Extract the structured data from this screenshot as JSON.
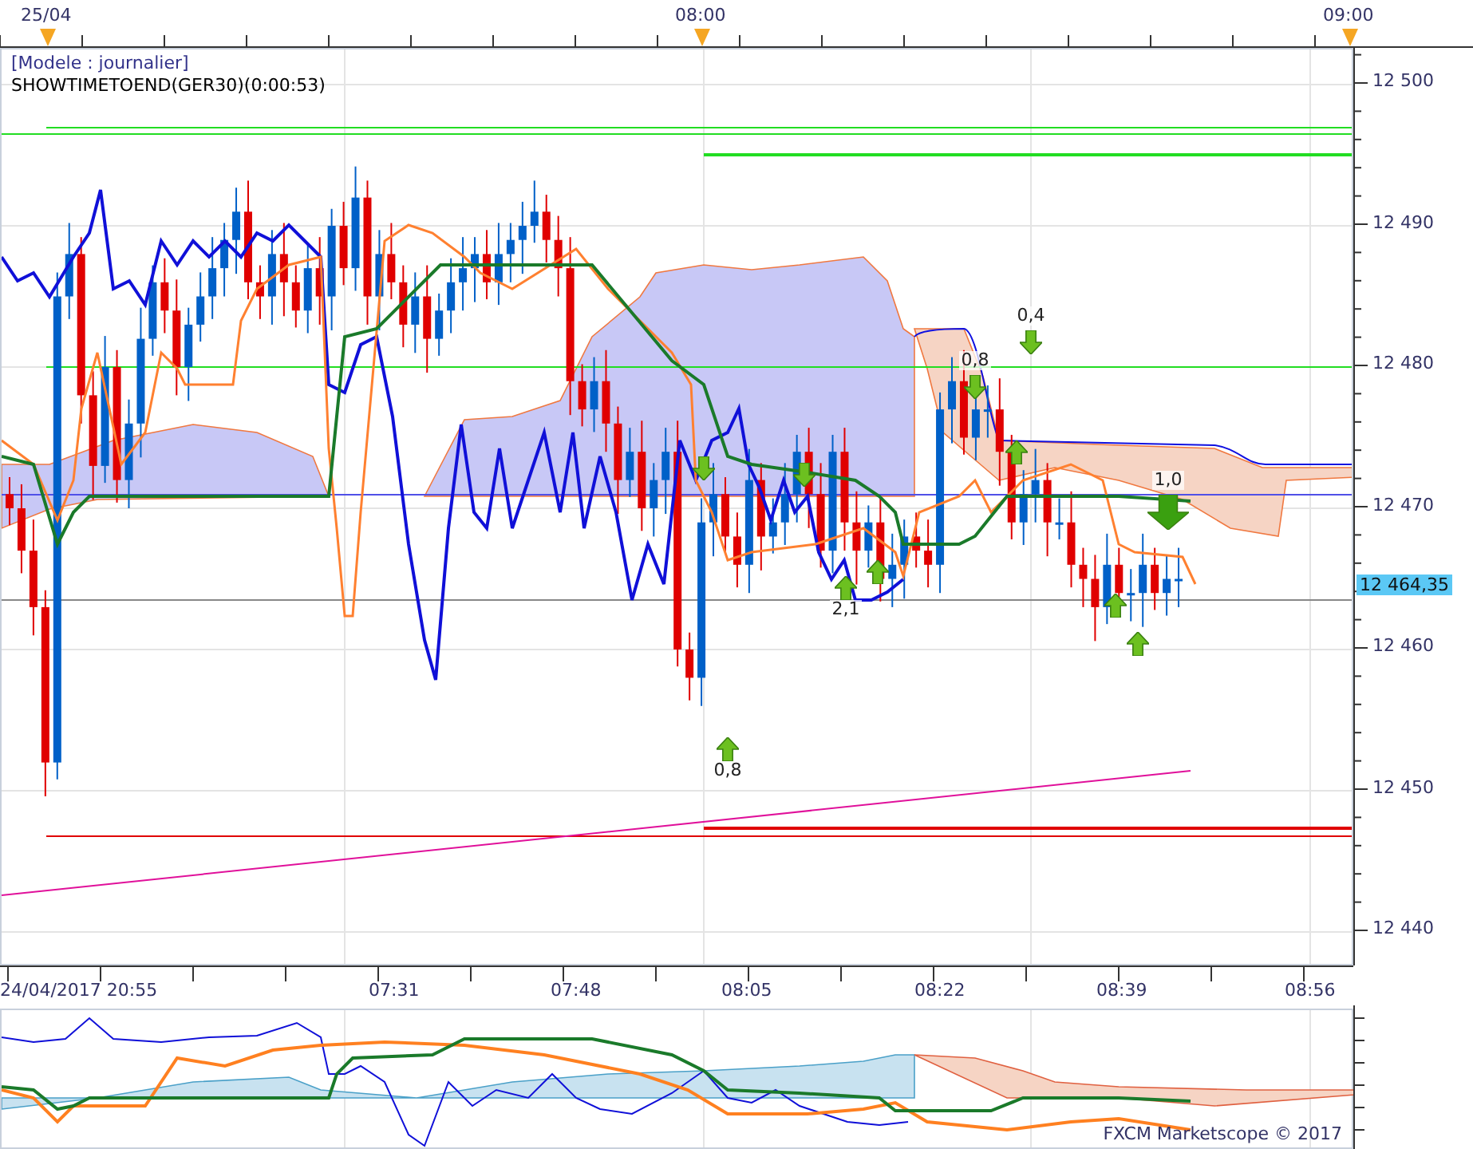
{
  "top_axis": {
    "labels": [
      "25/04",
      "08:00",
      "09:00"
    ]
  },
  "legend": {
    "model": "[Modele : journalier]",
    "indicator": "SHOWTIMETOEND(GER30)(0:00:53)"
  },
  "price_axis": {
    "labels": [
      "12 500",
      "12 490",
      "12 480",
      "12 470",
      "12 460",
      "12 450",
      "12 440"
    ],
    "current_price": "12 464,35"
  },
  "signals": [
    {
      "kind": "down"
    },
    {
      "kind": "up",
      "label": "0,8"
    },
    {
      "kind": "down"
    },
    {
      "kind": "up",
      "label": "2,1"
    },
    {
      "kind": "up"
    },
    {
      "kind": "down",
      "label": "0,8"
    },
    {
      "kind": "down",
      "label": "0,4"
    },
    {
      "kind": "up"
    },
    {
      "kind": "up"
    },
    {
      "kind": "up"
    },
    {
      "kind": "big-down",
      "label": "1,0"
    }
  ],
  "time_axis": {
    "labels": [
      "24/04/2017 20:55",
      "07:31",
      "07:48",
      "08:05",
      "08:22",
      "08:39",
      "08:56"
    ]
  },
  "credit": "FXCM Marketscope © 2017"
}
